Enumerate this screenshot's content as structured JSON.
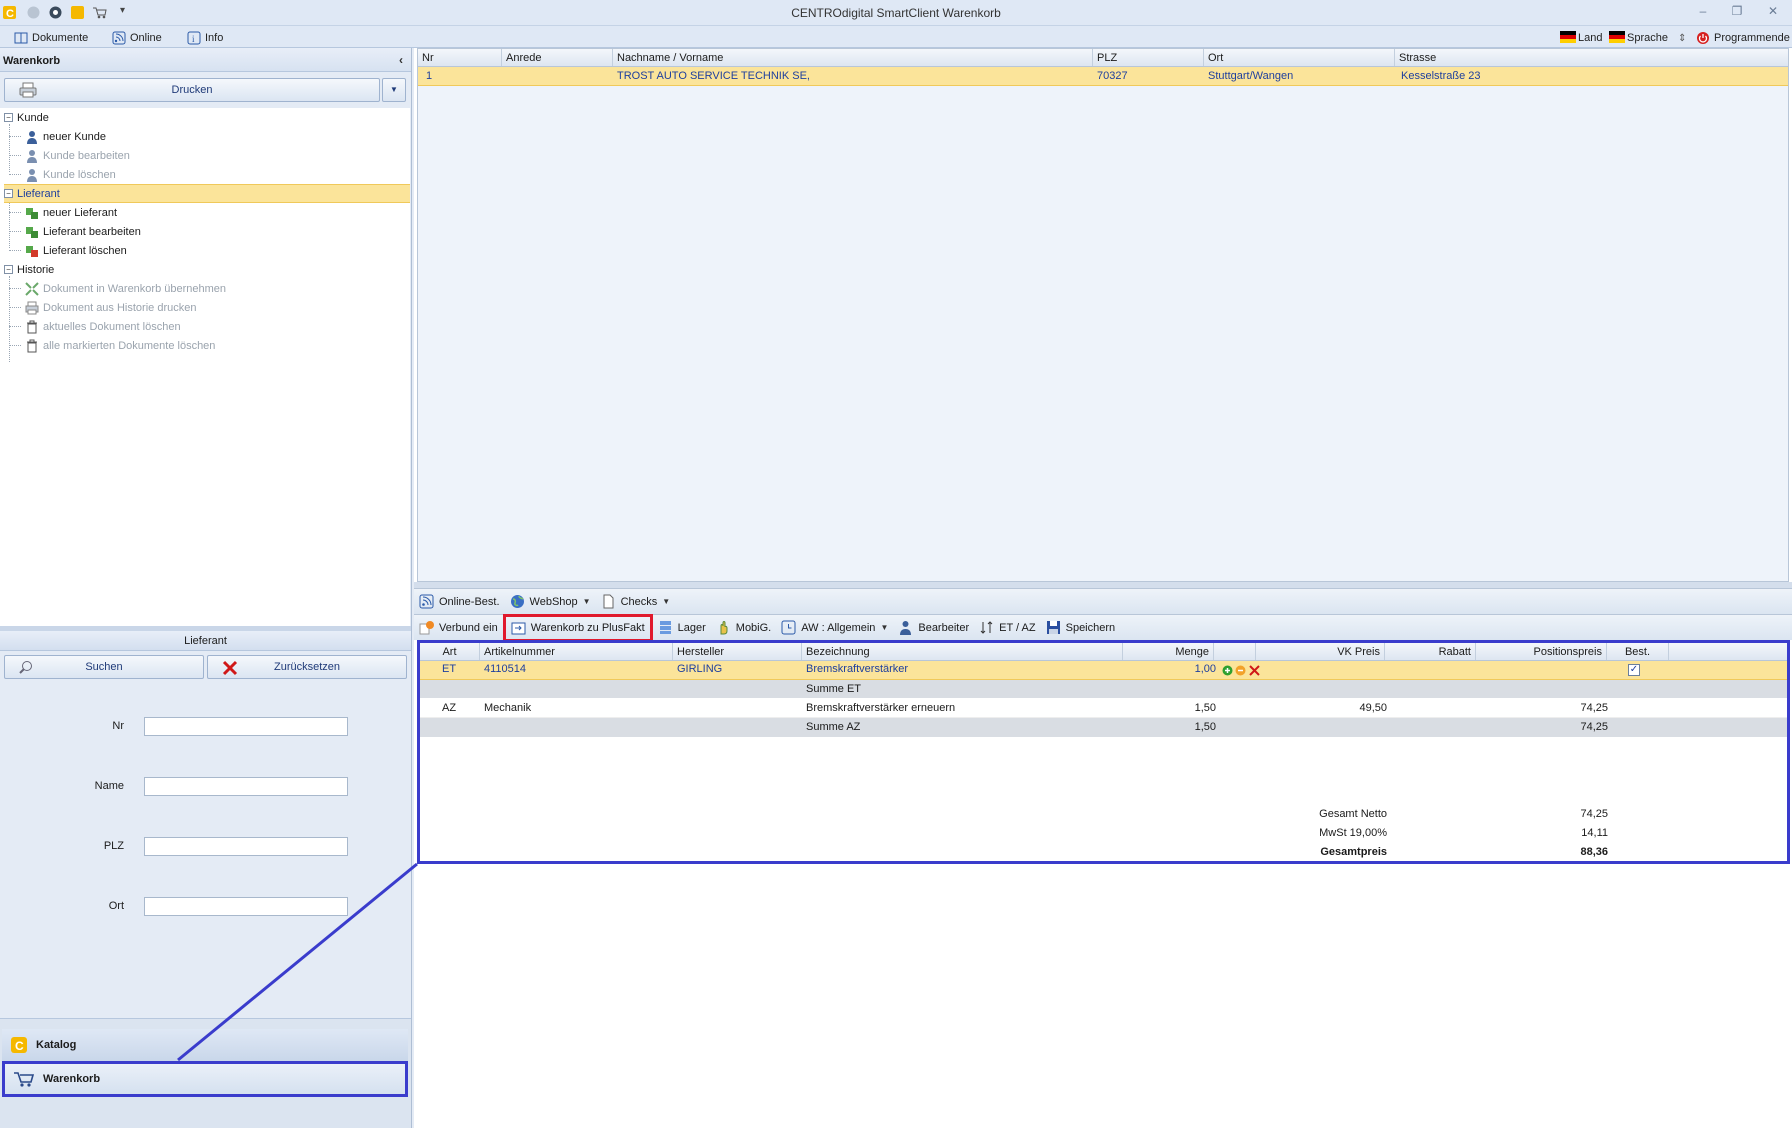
{
  "window": {
    "title": "CENTROdigital SmartClient Warenkorb"
  },
  "menubar": {
    "dokumente": "Dokumente",
    "online": "Online",
    "info": "Info",
    "land": "Land",
    "sprache": "Sprache",
    "programmende": "Programmende"
  },
  "left": {
    "header": "Warenkorb",
    "print_button": "Drucken",
    "tree": {
      "kunde": {
        "label": "Kunde",
        "items": [
          "neuer Kunde",
          "Kunde bearbeiten",
          "Kunde löschen"
        ]
      },
      "lieferant": {
        "label": "Lieferant",
        "items": [
          "neuer Lieferant",
          "Lieferant bearbeiten",
          "Lieferant löschen"
        ]
      },
      "historie": {
        "label": "Historie",
        "items": [
          "Dokument in Warenkorb übernehmen",
          "Dokument aus Historie drucken",
          "aktuelles Dokument löschen",
          "alle markierten Dokumente löschen"
        ]
      }
    },
    "search": {
      "header": "Lieferant",
      "search_button": "Suchen",
      "reset_button": "Zurücksetzen",
      "fields": {
        "nr": "Nr",
        "name": "Name",
        "plz": "PLZ",
        "ort": "Ort"
      }
    },
    "nav": {
      "katalog": "Katalog",
      "warenkorb": "Warenkorb"
    }
  },
  "supplier_grid": {
    "columns": [
      "Nr",
      "Anrede",
      "Nachname / Vorname",
      "PLZ",
      "Ort",
      "Strasse"
    ],
    "rows": [
      {
        "nr": "1",
        "anrede": "",
        "name": "TROST AUTO SERVICE TECHNIK SE,",
        "plz": "70327",
        "ort": "Stuttgart/Wangen",
        "strasse": "Kesselstraße 23"
      }
    ]
  },
  "toolbar1": {
    "online_best": "Online-Best.",
    "webshop": "WebShop",
    "checks": "Checks"
  },
  "toolbar2": {
    "verbund": "Verbund ein",
    "plusfakt": "Warenkorb zu PlusFakt",
    "lager": "Lager",
    "mobig": "MobiG.",
    "aw": "AW : Allgemein",
    "bearbeiter": "Bearbeiter",
    "etaz": "ET / AZ",
    "speichern": "Speichern"
  },
  "cart_grid": {
    "columns": [
      "Art",
      "Artikelnummer",
      "Hersteller",
      "Bezeichnung",
      "Menge",
      "VK Preis",
      "Rabatt",
      "Positionspreis",
      "Best."
    ],
    "rows": [
      {
        "art": "ET",
        "artnr": "4110514",
        "hersteller": "GIRLING",
        "bez": "Bremskraftverstärker",
        "menge": "1,00",
        "vk": "",
        "rabatt": "",
        "pos": "",
        "best": true
      },
      {
        "art": "",
        "artnr": "",
        "hersteller": "",
        "bez": "Summe ET",
        "menge": "",
        "vk": "",
        "rabatt": "",
        "pos": "",
        "best": false
      },
      {
        "art": "AZ",
        "artnr": "Mechanik",
        "hersteller": "",
        "bez": "Bremskraftverstärker erneuern",
        "menge": "1,50",
        "vk": "49,50",
        "rabatt": "",
        "pos": "74,25",
        "best": false
      },
      {
        "art": "",
        "artnr": "",
        "hersteller": "",
        "bez": "Summe AZ",
        "menge": "1,50",
        "vk": "",
        "rabatt": "",
        "pos": "74,25",
        "best": false
      }
    ],
    "totals": {
      "netto_label": "Gesamt Netto",
      "netto": "74,25",
      "mwst_label": "MwSt 19,00%",
      "mwst": "14,11",
      "gesamt_label": "Gesamtpreis",
      "gesamt": "88,36"
    }
  },
  "colors": {
    "highlight_red": "#e0192d",
    "highlight_blue": "#3a3ccc",
    "selection": "#fbe49a"
  }
}
